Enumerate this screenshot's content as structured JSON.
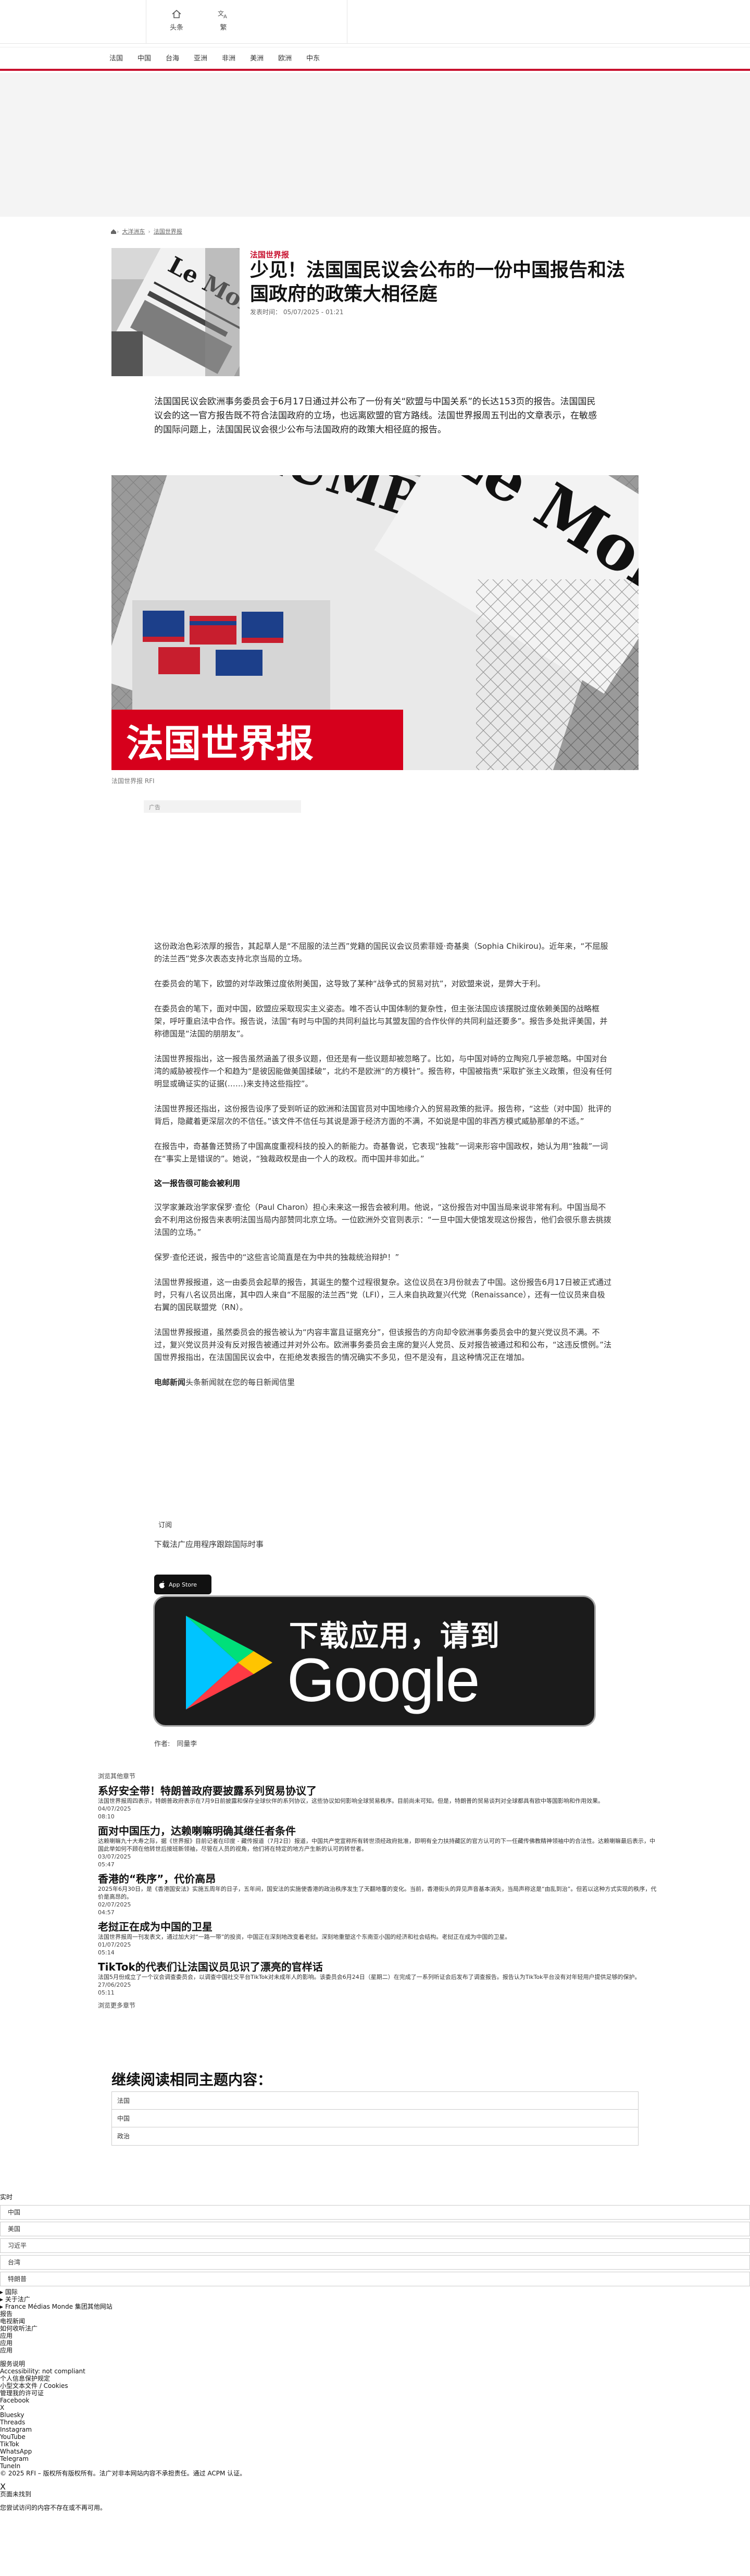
{
  "header": {
    "tools": [
      {
        "label": "头条",
        "icon": "home-icon"
      },
      {
        "label": "繁",
        "icon": "translate-icon"
      }
    ],
    "nav": [
      "法国",
      "中国",
      "台海",
      "亚洲",
      "非洲",
      "美洲",
      "欧洲",
      "中东"
    ]
  },
  "breadcrumb": [
    "头条",
    "大洋洲东",
    "法国世界报"
  ],
  "article": {
    "kicker": "法国世界报",
    "title": "少见！法国国民议会公布的一份中国报告和法国政府的政策大相径庭",
    "published": "发表时间： 05/07/2025 - 01:21",
    "lead": "法国国民议会欧洲事务委员会于6月17日通过并公布了一份有关“欧盟与中国关系”的长达153页的报告。法国国民议会的这一官方报告既不符合法国政府的立场，也远离欧盟的官方路线。法国世界报周五刊出的文章表示，在敏感的国际问题上，法国国民议会很少公布与法国政府的政策大相径庭的报告。",
    "image_caption": "法国世界报 RFI",
    "ad_label": "广告",
    "paragraphs": [
      "这份政治色彩浓厚的报告，其起草人是“不屈服的法兰西”党籍的国民议会议员索菲娅·奇基奥（Sophia Chikirou)。近年来，“不屈服的法兰西”党多次表态支持北京当局的立场。",
      "在委员会的笔下，欧盟的对华政策过度依附美国，这导致了某种“战争式的贸易对抗”，对欧盟来说，是弊大于利。",
      "在委员会的笔下，面对中国，欧盟应采取现实主义姿态。唯不否认中国体制的复杂性，但主张法国应该摆脱过度依赖美国的战略框架，呼吁重启法中合作。报告说，法国“有时与中国的共同利益比与其盟友国的合作伙伴的共同利益还要多”。报告多处批评美国，并称德国是“法国的朋朋友”。",
      "法国世界报指出，这一报告虽然涵盖了很多议题，但还是有一些议题却被忽略了。比如，与中国对峙的立陶宛几乎被忽略。中国对台湾的威胁被视作一个和趋为“是彼因能做美国揉破”，北约不是欧洲“的方模针”。报告称，中国被指责“采取扩张主义政策，但没有任何明显或确证实的证据(……)来支持这些指控”。",
      "法国世界报还指出，这份报告设序了受到听证的欧洲和法国官员对中国地缘介入的贸易政策的批评。报告称，“这些（对中国）批评的背后，隐藏着更深层次的不信任。”该文件不信任与其说是源于经济方面的不满，不如说是中国的非西方模式威胁那单的不适。”",
      "在报告中，奇基鲁还赞扬了中国高度重视科技的投入的新能力。奇基鲁说，它表现“独裁”一词来形容中国政权，她认为用“独裁”一词在“事实上是错误的”。她说，“独裁政权是由一个人的政权。而中国并非如此。”"
    ],
    "subheading": "这一报告很可能会被利用",
    "paragraphs2": [
      "汉学家兼政治学家保罗·查伦（Paul Charon）担心未来这一报告会被利用。他说，“这份报告对中国当局来说非常有利。中国当局不会不利用这份报告来表明法国当局内部赞同北京立场。一位欧洲外交官则表示：“一旦中国大使馆发现这份报告，他们会很乐意去挑拨法国的立场。”",
      "保罗·查伦还说，报告中的“这些言论简直是在为中共的独裁统治辩护！”",
      "法国世界报报道，这一由委员会起草的报告，其诞生的整个过程很复杂。这位议员在3月份就去了中国。这份报告6月17日被正式通过时，只有八名议员出席，其中四人来自“不屈服的法兰西”党（LFI），三人来自执政复兴代党（Renaissance），还有一位议员来自极右翼的国民联盟党（RN）。",
      "法国世界报报道，虽然委员会的报告被认为“内容丰富且证据充分”，但该报告的方向却令欧洲事务委员会中的复兴党议员不满。不过，复兴党议员并没有反对报告被通过并对外公布。欧洲事务委员会主席的复兴人党员、反对报告被通过和和公布，“这违反惯例。”法国世界报指出，在法国国民议会中，在拒绝发表报告的情况确实不多见，但不是没有，且这种情况正在增加。"
    ],
    "newsletter": {
      "brand": "电邮新闻",
      "text": "头条新闻就在您的每日新闻信里"
    },
    "subscribe_label": "订阅",
    "download_text": "下载法广应用程序跟踪国际时事",
    "appstore_label": "App Store",
    "play_top": "下载应用，请到",
    "play_main": "Google Play",
    "author": "作者:　同量李"
  },
  "read_also": {
    "title": "浏览其他章节",
    "items": [
      {
        "title": "系好安全带！特朗普政府要披露系列贸易协议了",
        "desc": "法国世界报周四表示，特朗普政府表示在7月9日前披露和保存全球伙伴的系列协议，这些协议如何影响全球贸易秩序。目前尚未可知。但是，特朗普的贸易谈判对全球都具有欧中等国影响和作用效果。",
        "date": "04/07/2025",
        "time": "08:10"
      },
      {
        "title": "面对中国压力，达赖喇嘛明确其继任者条件",
        "desc": "达赖喇嘛九十大寿之际，据《世界报》目前记者在印度 - 藏传报道（7月2日）报道，中国共产党宣称所有转世须经政府批准，即明有全力扶持藏区的官方认可的下一任藏传佛教精神领袖中的合法性。达赖喇嘛最后表示，中国此举如何不顾在他转世后接班新领袖，尽管在人员的视角，他们将在特定的地方产生新的认可的转世者。",
        "date": "03/07/2025",
        "time": "05:47"
      },
      {
        "title": "香港的“秩序”，代价高昂",
        "desc": "2025年6月30日，是《香港国安法》实施五周年的日子，五年间，国安法的实施使香港的政治秩序发生了天翻地覆的变化。当前，香港街头的异见声音基本消失，当局声称这是“由乱到治”。但若以这种方式实现的秩序，代价是高昂的。",
        "date": "02/07/2025",
        "time": "04:57"
      },
      {
        "title": "老挝正在成为中国的卫星",
        "desc": "法国世界报周一刊发表文，通过加大对“一路一带”的投资，中国正在深刻地改变着老挝。深刻地重塑这个东南亚小国的经济和社会结构。老挝正在成为中国的卫星。",
        "date": "01/07/2025",
        "time": "05:14"
      },
      {
        "title": "TikTok的代表们让法国议员见识了漂亮的官样话",
        "desc": "法国5月份成立了一个议会调查委员会，以调查中国社交平台TikTok对未成年人的影响。该委员会6月24日（星期二）在完成了一系列听证会后发布了调查报告。报告认为TikTok平台没有对年轻用户提供足够的保护。",
        "date": "27/06/2025",
        "time": "05:11"
      }
    ],
    "more": "浏览更多章节"
  },
  "related": {
    "title": "继续阅读相同主题内容：",
    "tags": [
      "法国",
      "中国",
      "政治"
    ]
  },
  "footer": {
    "realtime_label": "实时",
    "realtime_items": [
      "中国",
      "美国",
      "习近平",
      "台湾",
      "特朗普",
      "首尔"
    ],
    "lines_a": [
      "▸ 国际",
      "▸ 关于法广",
      "▸ France Médias Monde 集团其他网站"
    ],
    "lines_b": [
      "报告",
      "电视新闻",
      "如何收听法广",
      "应用",
      "应用",
      "应用"
    ],
    "lines_c": [
      "服务说明",
      "Accessibility: not compliant",
      "个人信息保护规定",
      "小型文本文件 / Cookies",
      "管理我的许可证"
    ],
    "social": [
      "Facebook",
      "X",
      "Bluesky",
      "Threads",
      "Instagram",
      "YouTube",
      "TikTok",
      "WhatsApp",
      "Telegram",
      "TuneIn"
    ],
    "copyright": "© 2025 RFI – 版权所有版权所有。法广对非本网站内容不承担责任。通过 ACPM 认证。",
    "close_label": "X",
    "not_found": "页面未找到",
    "not_found_desc": "您尝试访问的内容不存在或不再可用。"
  },
  "colors": {
    "accent": "#c8102e"
  }
}
